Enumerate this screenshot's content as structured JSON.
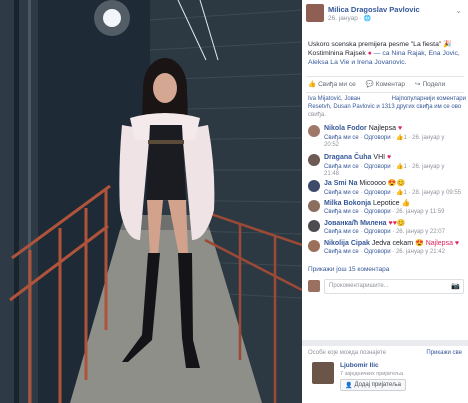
{
  "post": {
    "author": "Milica Dragoslav Pavlovic",
    "date": "26. јануар",
    "text_line1": "Uskoro scenska premijera pesme \"La fiesta\"",
    "text_line2_prefix": "Kostimlnina Rajsek",
    "text_line2_suffix": " — са Nina Rajak, Ena Jovic,",
    "text_line3": "Aleksa La Vie и Irena Jovanovic."
  },
  "actions": {
    "like": "Свиђа ми се",
    "comment": "Коментар",
    "share": "Подели"
  },
  "likes_summary": {
    "line1_names": "Iva Mijatović, Јован",
    "line1_right": "Најпопуларнији коментари",
    "line2": "Resetvh, Dusan Pavlovic и 1313 других свиђа им се ово",
    "line3": "свиђа."
  },
  "comments": [
    {
      "name": "Nikola Fodor",
      "text": "Najlepsa",
      "emoji": "♥",
      "like": "Свиђа ми се",
      "reply": "Одговори",
      "count": "1",
      "date": "26. јануар у",
      "time": "20:52",
      "avatar_color": "#a0786a"
    },
    {
      "name": "Dragana Čuha",
      "text": "VHI",
      "emoji": "♥",
      "like": "Свиђа ми се",
      "reply": "Одговори",
      "count": "1",
      "date": "26. јануар у",
      "time": "21:48",
      "avatar_color": "#6c5a54"
    },
    {
      "name": "Ja Smi Na",
      "text": "Micoooo",
      "emoji": "😍😊",
      "like": "Свиђа ми се",
      "reply": "Одговори",
      "count": "1",
      "date": "28. јануар у 09:55",
      "time": "",
      "avatar_color": "#3e4a6a"
    },
    {
      "name": "Milka Bokonja",
      "text": "Lepotice",
      "emoji": "👍",
      "like": "Свиђа ми се",
      "reply": "Одговори",
      "count": "",
      "date": "26. јануар у 11:59",
      "time": "",
      "avatar_color": "#8b6e5e"
    },
    {
      "name": "Јованка/ћ Милена",
      "text": "",
      "emoji": "♥♥😊",
      "like": "Свиђа ми се",
      "reply": "Одговори",
      "count": "",
      "date": "26. јануар у 22:07",
      "time": "",
      "avatar_color": "#4b4b50"
    },
    {
      "name": "Nikolija Cipak",
      "text": "Jedva cekam",
      "emoji": "😍 Najlepsa ♥",
      "like": "Свиђа ми се",
      "reply": "Одговори",
      "count": "",
      "date": "26. јануар у 21:42",
      "time": "",
      "avatar_color": "#9c6f5a"
    }
  ],
  "more_comments": "Прикажи још 15 коментара",
  "comment_input_placeholder": "Прокоментаришите...",
  "suggestions": {
    "header": "Особе које можда познајете",
    "see_all": "Прикажи све",
    "person_name": "Ljubomir Ilic",
    "mutual": "7 заједничких пријатеља",
    "add_friend": "Додај пријатеља"
  },
  "colors": {
    "link": "#365899",
    "muted": "#90949c",
    "heart": "#e0245e"
  }
}
